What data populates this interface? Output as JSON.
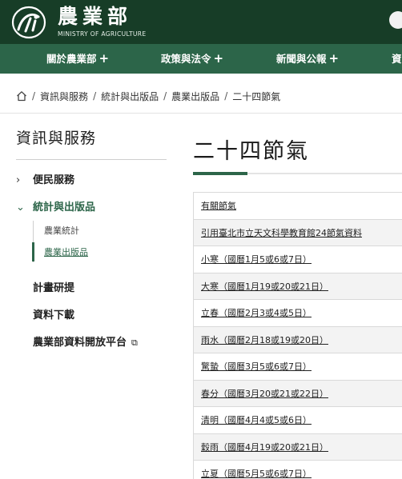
{
  "header": {
    "site_name": "農業部",
    "site_name_en": "MINISTRY OF AGRICULTURE"
  },
  "nav": {
    "items": [
      {
        "label": "關於農業部"
      },
      {
        "label": "政策與法令"
      },
      {
        "label": "新聞與公報"
      },
      {
        "label": "資"
      }
    ],
    "plus_symbol": "+"
  },
  "breadcrumb": {
    "items": [
      "資訊與服務",
      "統計與出版品",
      "農業出版品",
      "二十四節氣"
    ],
    "separator": "/"
  },
  "sidebar": {
    "title": "資訊與服務",
    "items": [
      {
        "label": "便民服務"
      },
      {
        "label": "統計與出版品"
      },
      {
        "label": "計畫研提"
      },
      {
        "label": "資料下載"
      },
      {
        "label": "農業部資料開放平台"
      }
    ],
    "subitems": [
      {
        "label": "農業統計"
      },
      {
        "label": "農業出版品"
      }
    ]
  },
  "main": {
    "title": "二十四節氣",
    "links": [
      {
        "label": "有關節氣"
      },
      {
        "label": "引用臺北市立天文科學教育館24節氣資料"
      },
      {
        "label": "小寒（國曆1月5或6或7日）"
      },
      {
        "label": "大寒（國曆1月19或20或21日）"
      },
      {
        "label": "立春（國曆2月3或4或5日）"
      },
      {
        "label": "雨水（國曆2月18或19或20日）"
      },
      {
        "label": "驚蟄（國曆3月5或6或7日）"
      },
      {
        "label": "春分（國曆3月20或21或22日）"
      },
      {
        "label": "清明（國曆4月4或5或6日）"
      },
      {
        "label": "穀雨（國曆4月19或20或21日）"
      },
      {
        "label": "立夏（國曆5月5或6或7日）"
      }
    ]
  },
  "icons": {
    "chevron_right": "›",
    "chevron_down": "⌄",
    "external_link": "⧉"
  },
  "colors": {
    "header_bg": "#173d27",
    "nav_bg": "#2c6549",
    "accent": "#2c6549"
  }
}
